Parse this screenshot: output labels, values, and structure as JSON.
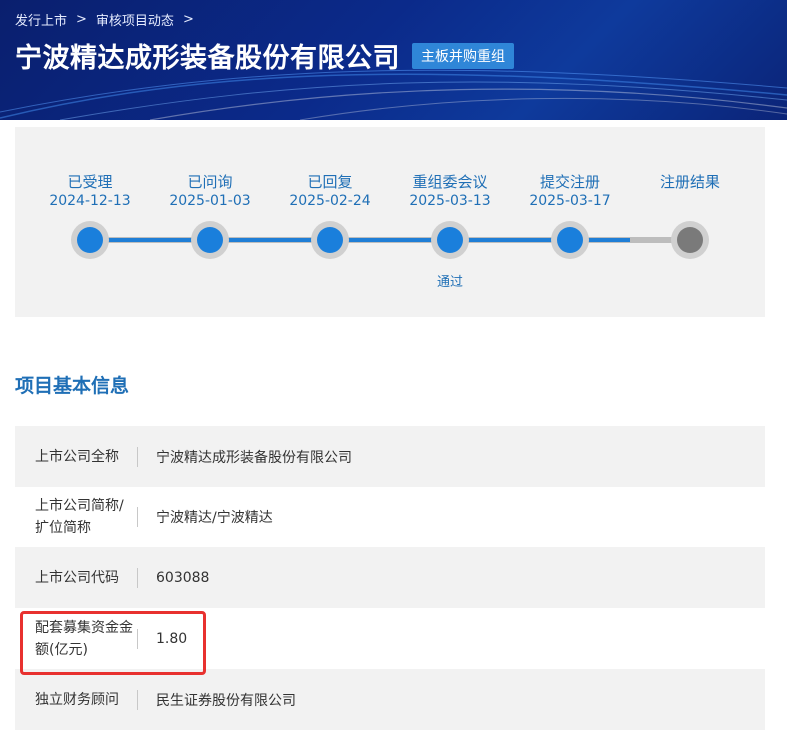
{
  "breadcrumb": {
    "items": [
      "发行上市",
      "审核项目动态"
    ],
    "separator": ">"
  },
  "header": {
    "title": "宁波精达成形装备股份有限公司",
    "tag": "主板并购重组"
  },
  "progress": {
    "steps": [
      {
        "label": "已受理",
        "date": "2024-12-13",
        "status": "done"
      },
      {
        "label": "已问询",
        "date": "2025-01-03",
        "status": "done"
      },
      {
        "label": "已回复",
        "date": "2025-02-24",
        "status": "done"
      },
      {
        "label": "重组委会议",
        "date": "2025-03-13",
        "status": "done",
        "note": "通过"
      },
      {
        "label": "提交注册",
        "date": "2025-03-17",
        "status": "done"
      },
      {
        "label": "注册结果",
        "date": "",
        "status": "pending"
      }
    ]
  },
  "section": {
    "title": "项目基本信息"
  },
  "info": {
    "rows": [
      {
        "label": "上市公司全称",
        "value": "宁波精达成形装备股份有限公司"
      },
      {
        "label": "上市公司简称/扩位简称",
        "value": "宁波精达/宁波精达"
      },
      {
        "label": "上市公司代码",
        "value": "603088"
      },
      {
        "label": "配套募集资金金额(亿元)",
        "value": "1.80"
      },
      {
        "label": "独立财务顾问",
        "value": "民生证券股份有限公司"
      }
    ]
  },
  "colors": {
    "accent": "#1f6fb6",
    "step_done": "#1a7fdc",
    "step_pending": "#7a7a7a",
    "highlight": "#e8312f",
    "banner": "#0b2a8a"
  }
}
